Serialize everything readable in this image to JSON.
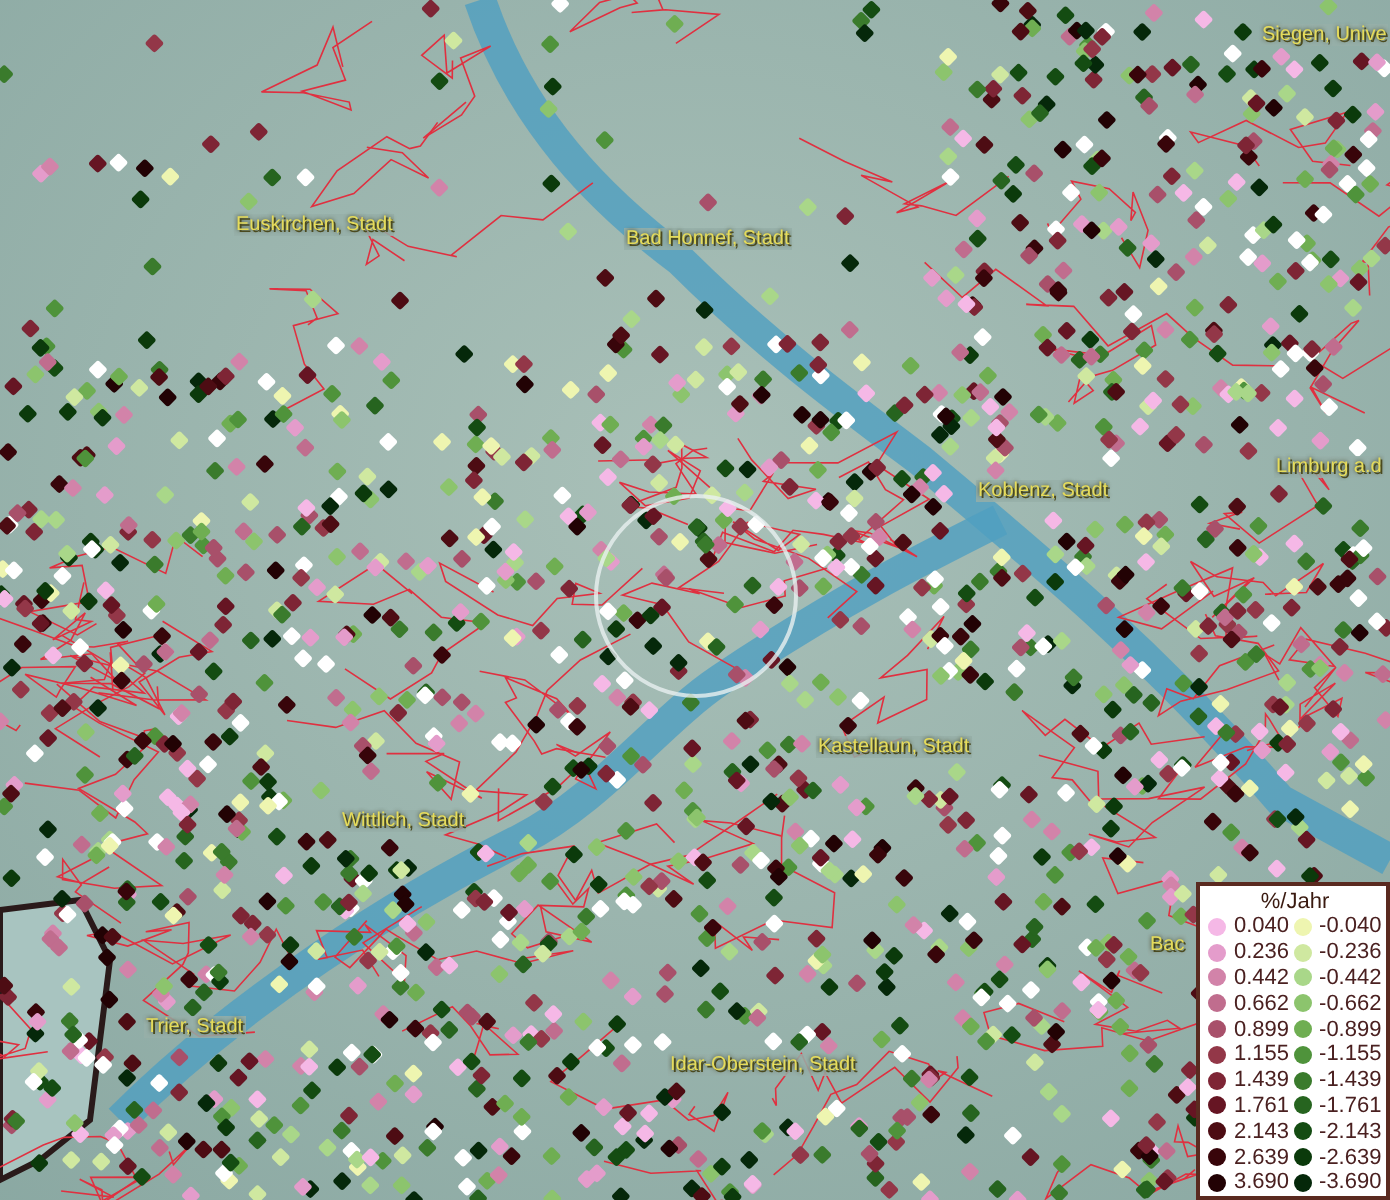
{
  "map": {
    "places": [
      {
        "name": "Siegen, Unive"
      },
      {
        "name": "Euskirchen, Stadt"
      },
      {
        "name": "Bad Honnef, Stadt"
      },
      {
        "name": "Limburg a.d"
      },
      {
        "name": "Koblenz, Stadt"
      },
      {
        "name": "Kastellaun, Stadt"
      },
      {
        "name": "Wittlich, Stadt"
      },
      {
        "name": "Bac"
      },
      {
        "name": "Trier, Stadt"
      },
      {
        "name": "Idar-Oberstein, Stadt"
      }
    ]
  },
  "legend": {
    "title": "%/Jahr",
    "positive": [
      {
        "label": "0.040",
        "color": "#f5b8e6"
      },
      {
        "label": "0.236",
        "color": "#e49ccb"
      },
      {
        "label": "0.442",
        "color": "#d283a9"
      },
      {
        "label": "0.662",
        "color": "#c06d8e"
      },
      {
        "label": "0.899",
        "color": "#a8506a"
      },
      {
        "label": "1.155",
        "color": "#933748"
      },
      {
        "label": "1.439",
        "color": "#7e2535"
      },
      {
        "label": "1.761",
        "color": "#661523"
      },
      {
        "label": "2.143",
        "color": "#4d0c13"
      },
      {
        "label": "2.639",
        "color": "#38050a"
      },
      {
        "label": "3.690",
        "color": "#220204"
      }
    ],
    "negative": [
      {
        "label": "-0.040",
        "color": "#eef5b0"
      },
      {
        "label": "-0.236",
        "color": "#cfe8a0"
      },
      {
        "label": "-0.442",
        "color": "#a9d789"
      },
      {
        "label": "-0.662",
        "color": "#8cc46d"
      },
      {
        "label": "-0.899",
        "color": "#6fae52"
      },
      {
        "label": "-1.155",
        "color": "#4f933b"
      },
      {
        "label": "-1.439",
        "color": "#3a7b2c"
      },
      {
        "label": "-1.761",
        "color": "#26641f"
      },
      {
        "label": "-2.143",
        "color": "#144c12"
      },
      {
        "label": "-2.639",
        "color": "#0b3a0b"
      },
      {
        "label": "-3.690",
        "color": "#05280a"
      }
    ]
  }
}
